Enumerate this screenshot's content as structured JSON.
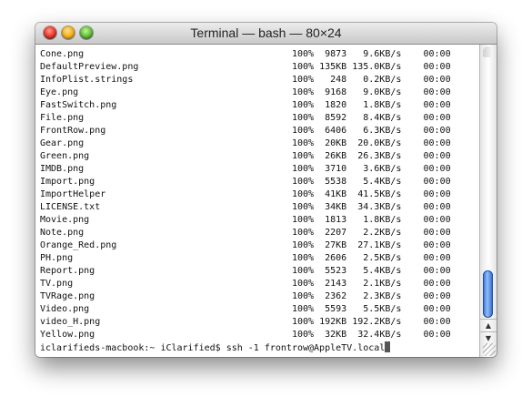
{
  "window": {
    "title": "Terminal — bash — 80×24"
  },
  "rows": [
    {
      "name": "Cone.png",
      "pct": "100%",
      "size": "9873",
      "rate": "9.6KB/s",
      "time": "00:00"
    },
    {
      "name": "DefaultPreview.png",
      "pct": "100%",
      "size": "135KB",
      "rate": "135.0KB/s",
      "time": "00:00"
    },
    {
      "name": "InfoPlist.strings",
      "pct": "100%",
      "size": "248",
      "rate": "0.2KB/s",
      "time": "00:00"
    },
    {
      "name": "Eye.png",
      "pct": "100%",
      "size": "9168",
      "rate": "9.0KB/s",
      "time": "00:00"
    },
    {
      "name": "FastSwitch.png",
      "pct": "100%",
      "size": "1820",
      "rate": "1.8KB/s",
      "time": "00:00"
    },
    {
      "name": "File.png",
      "pct": "100%",
      "size": "8592",
      "rate": "8.4KB/s",
      "time": "00:00"
    },
    {
      "name": "FrontRow.png",
      "pct": "100%",
      "size": "6406",
      "rate": "6.3KB/s",
      "time": "00:00"
    },
    {
      "name": "Gear.png",
      "pct": "100%",
      "size": "20KB",
      "rate": "20.0KB/s",
      "time": "00:00"
    },
    {
      "name": "Green.png",
      "pct": "100%",
      "size": "26KB",
      "rate": "26.3KB/s",
      "time": "00:00"
    },
    {
      "name": "IMDB.png",
      "pct": "100%",
      "size": "3710",
      "rate": "3.6KB/s",
      "time": "00:00"
    },
    {
      "name": "Import.png",
      "pct": "100%",
      "size": "5538",
      "rate": "5.4KB/s",
      "time": "00:00"
    },
    {
      "name": "ImportHelper",
      "pct": "100%",
      "size": "41KB",
      "rate": "41.5KB/s",
      "time": "00:00"
    },
    {
      "name": "LICENSE.txt",
      "pct": "100%",
      "size": "34KB",
      "rate": "34.3KB/s",
      "time": "00:00"
    },
    {
      "name": "Movie.png",
      "pct": "100%",
      "size": "1813",
      "rate": "1.8KB/s",
      "time": "00:00"
    },
    {
      "name": "Note.png",
      "pct": "100%",
      "size": "2207",
      "rate": "2.2KB/s",
      "time": "00:00"
    },
    {
      "name": "Orange_Red.png",
      "pct": "100%",
      "size": "27KB",
      "rate": "27.1KB/s",
      "time": "00:00"
    },
    {
      "name": "PH.png",
      "pct": "100%",
      "size": "2606",
      "rate": "2.5KB/s",
      "time": "00:00"
    },
    {
      "name": "Report.png",
      "pct": "100%",
      "size": "5523",
      "rate": "5.4KB/s",
      "time": "00:00"
    },
    {
      "name": "TV.png",
      "pct": "100%",
      "size": "2143",
      "rate": "2.1KB/s",
      "time": "00:00"
    },
    {
      "name": "TVRage.png",
      "pct": "100%",
      "size": "2362",
      "rate": "2.3KB/s",
      "time": "00:00"
    },
    {
      "name": "Video.png",
      "pct": "100%",
      "size": "5593",
      "rate": "5.5KB/s",
      "time": "00:00"
    },
    {
      "name": "video_H.png",
      "pct": "100%",
      "size": "192KB",
      "rate": "192.2KB/s",
      "time": "00:00"
    },
    {
      "name": "Yellow.png",
      "pct": "100%",
      "size": "32KB",
      "rate": "32.4KB/s",
      "time": "00:00"
    }
  ],
  "prompt": {
    "text": "iclarifieds-macbook:~ iClarified$ ",
    "command": "ssh -1 frontrow@AppleTV.local"
  },
  "scrollbar": {
    "position": 0.98,
    "up_arrow": "▲",
    "down_arrow": "▼"
  },
  "colors": {
    "scroll_thumb": "#3a74d8",
    "close": "#e0271b",
    "minimize": "#f0a500",
    "zoom": "#4fb626"
  }
}
